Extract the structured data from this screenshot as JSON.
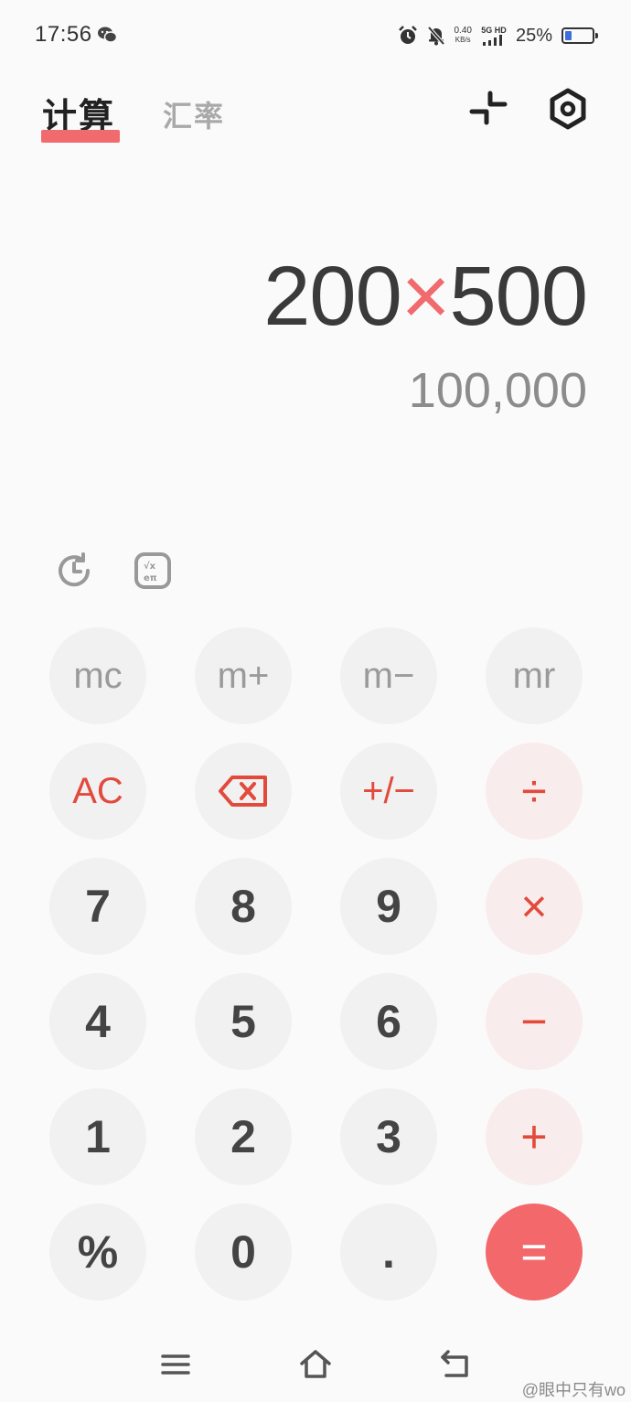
{
  "status": {
    "time": "17:56",
    "net_speed": "0.40",
    "net_unit": "KB/s",
    "network": "5G HD",
    "battery": "25%",
    "battery_level": 0.25
  },
  "tabs": {
    "calculator": "计算",
    "exchange_rate": "汇率"
  },
  "display": {
    "operand1": "200",
    "operator": "×",
    "operand2": "500",
    "result": "100,000"
  },
  "keys": {
    "mc": "mc",
    "mplus": "m+",
    "mminus": "m−",
    "mr": "mr",
    "ac": "AC",
    "sign": "+/−",
    "divide": "÷",
    "n7": "7",
    "n8": "8",
    "n9": "9",
    "multiply": "×",
    "n4": "4",
    "n5": "5",
    "n6": "6",
    "minus": "−",
    "n1": "1",
    "n2": "2",
    "n3": "3",
    "plus": "+",
    "percent": "%",
    "n0": "0",
    "dot": ".",
    "equals": "="
  },
  "watermark": "@眼中只有wo",
  "colors": {
    "accent": "#f06a6e",
    "operator": "#e24a3b",
    "key_bg": "#f1f1f1"
  }
}
